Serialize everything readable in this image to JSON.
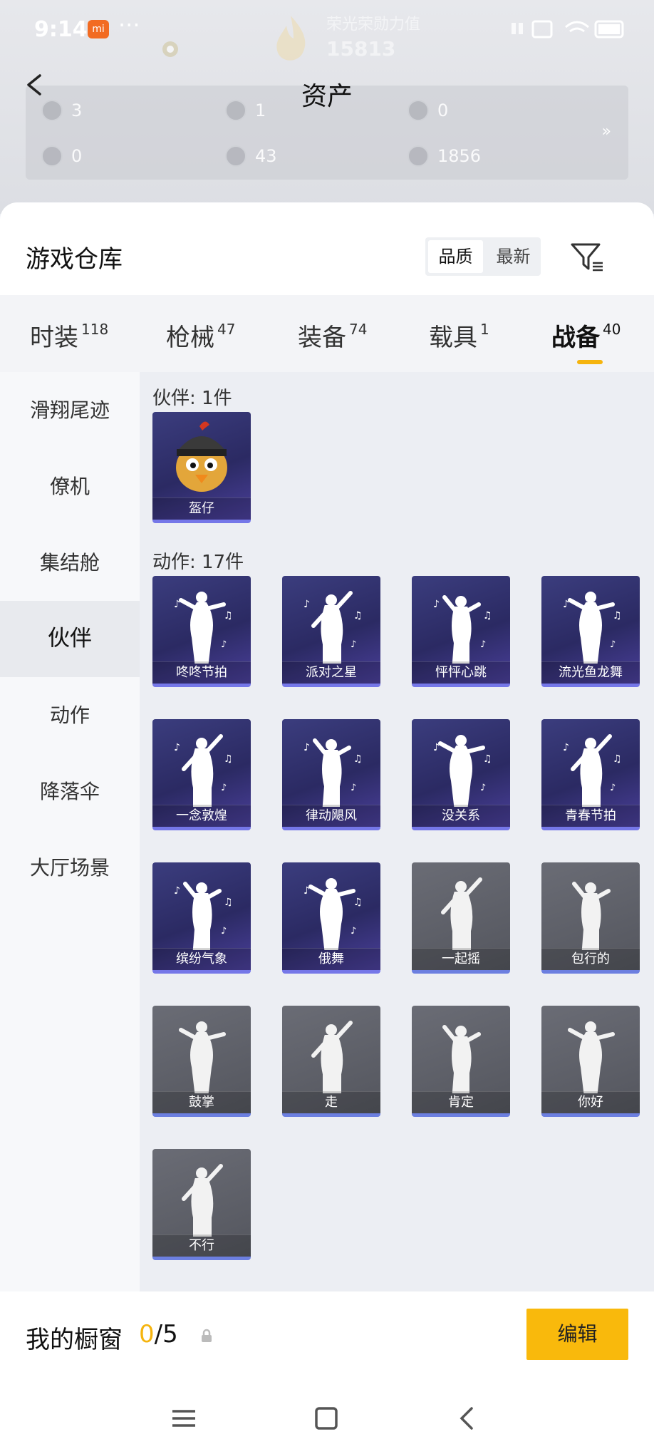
{
  "status_bar": {
    "time": "9:14",
    "dots": "···",
    "brand": "mi"
  },
  "background": {
    "ghost_text": "荣光荣勋力值",
    "ghost_number": "15813"
  },
  "header": {
    "title": "资产"
  },
  "assets": [
    {
      "icon": "ticket-icon",
      "value": "3"
    },
    {
      "icon": "coin-icon",
      "value": "1"
    },
    {
      "icon": "medal-icon",
      "value": "0"
    },
    {
      "icon": "gem-icon",
      "value": "0"
    },
    {
      "icon": "orb-icon",
      "value": "43"
    },
    {
      "icon": "gold-icon",
      "value": "1856"
    }
  ],
  "assets_more": "»",
  "warehouse": {
    "title": "游戏仓库",
    "sort": [
      "品质",
      "最新"
    ],
    "sort_active": 0
  },
  "tabs": [
    {
      "label": "时装",
      "count": "118"
    },
    {
      "label": "枪械",
      "count": "47"
    },
    {
      "label": "装备",
      "count": "74"
    },
    {
      "label": "载具",
      "count": "1"
    },
    {
      "label": "战备",
      "count": "40"
    }
  ],
  "side_menu": [
    "滑翔尾迹",
    "僚机",
    "集结舱",
    "伙伴",
    "动作",
    "降落伞",
    "大厅场景"
  ],
  "side_active": 3,
  "sections": {
    "companion": "伙伴: 1件",
    "actions": "动作: 17件"
  },
  "companion_items": [
    {
      "name": "盔仔",
      "style": "purple",
      "icon": "chick-helmet-icon"
    }
  ],
  "action_items": [
    {
      "name": "咚咚节拍",
      "style": "purple",
      "icon": "dance-figure-icon"
    },
    {
      "name": "派对之星",
      "style": "purple",
      "icon": "dance-figure-icon"
    },
    {
      "name": "怦怦心跳",
      "style": "purple",
      "icon": "dance-figure-icon"
    },
    {
      "name": "流光鱼龙舞",
      "style": "purple",
      "icon": "dragon-dance-icon"
    },
    {
      "name": "一念敦煌",
      "style": "purple",
      "icon": "dance-figure-icon"
    },
    {
      "name": "律动飓风",
      "style": "purple",
      "icon": "dance-figure-icon"
    },
    {
      "name": "没关系",
      "style": "purple",
      "icon": "dance-figure-icon"
    },
    {
      "name": "青春节拍",
      "style": "purple",
      "icon": "dance-figure-icon"
    },
    {
      "name": "缤纷气象",
      "style": "purple",
      "icon": "dance-figure-icon"
    },
    {
      "name": "俄舞",
      "style": "purple",
      "icon": "dance-figure-icon"
    },
    {
      "name": "一起摇",
      "style": "gray",
      "icon": "wave-figure-icon"
    },
    {
      "name": "包行的",
      "style": "gray",
      "icon": "fist-figure-icon"
    },
    {
      "name": "鼓掌",
      "style": "gray",
      "icon": "clap-hands-icon"
    },
    {
      "name": "走",
      "style": "gray",
      "icon": "pointing-hand-icon"
    },
    {
      "name": "肯定",
      "style": "gray",
      "icon": "nod-head-icon"
    },
    {
      "name": "你好",
      "style": "gray",
      "icon": "wave-hello-icon"
    },
    {
      "name": "不行",
      "style": "gray",
      "icon": "shake-head-icon"
    }
  ],
  "showcase": {
    "label": "我的橱窗",
    "current": "0",
    "total": "/5",
    "edit": "编辑"
  },
  "colors": {
    "accent": "#f9b90c",
    "card_purple": "#2f2e6b",
    "card_gray": "#5e6068"
  }
}
